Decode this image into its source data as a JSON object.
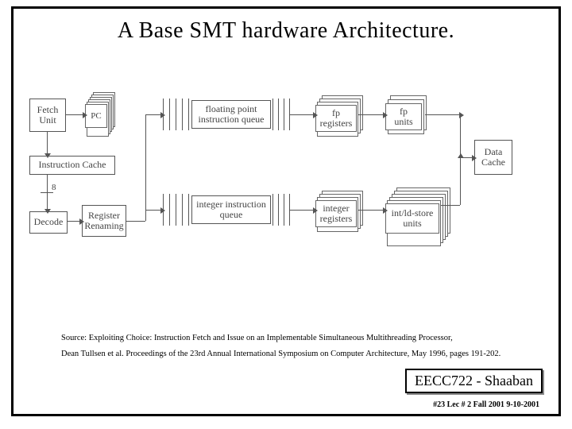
{
  "title": "A Base SMT hardware Architecture.",
  "blocks": {
    "fetch_unit": "Fetch\nUnit",
    "pc": "PC",
    "instruction_cache": "Instruction Cache",
    "decode": "Decode",
    "register_renaming": "Register\nRenaming",
    "fp_queue": "floating point\ninstruction queue",
    "int_queue": "integer\ninstruction queue",
    "fp_registers": "fp\nregisters",
    "fp_units": "fp\nunits",
    "int_registers": "integer\nregisters",
    "intld_units": "int/ld-store\nunits",
    "data_cache": "Data\nCache",
    "bus_width": "8"
  },
  "source": {
    "line1": "Source: Exploiting Choice: Instruction Fetch and Issue on an Implementable Simultaneous Multithreading Processor,",
    "line2": "Dean Tullsen et al. Proceedings of the 23rd Annual International Symposium on Computer Architecture, May 1996, pages 191-202."
  },
  "footer": {
    "course": "EECC722 - Shaaban",
    "meta": "#23   Lec # 2   Fall 2001 9-10-2001"
  }
}
